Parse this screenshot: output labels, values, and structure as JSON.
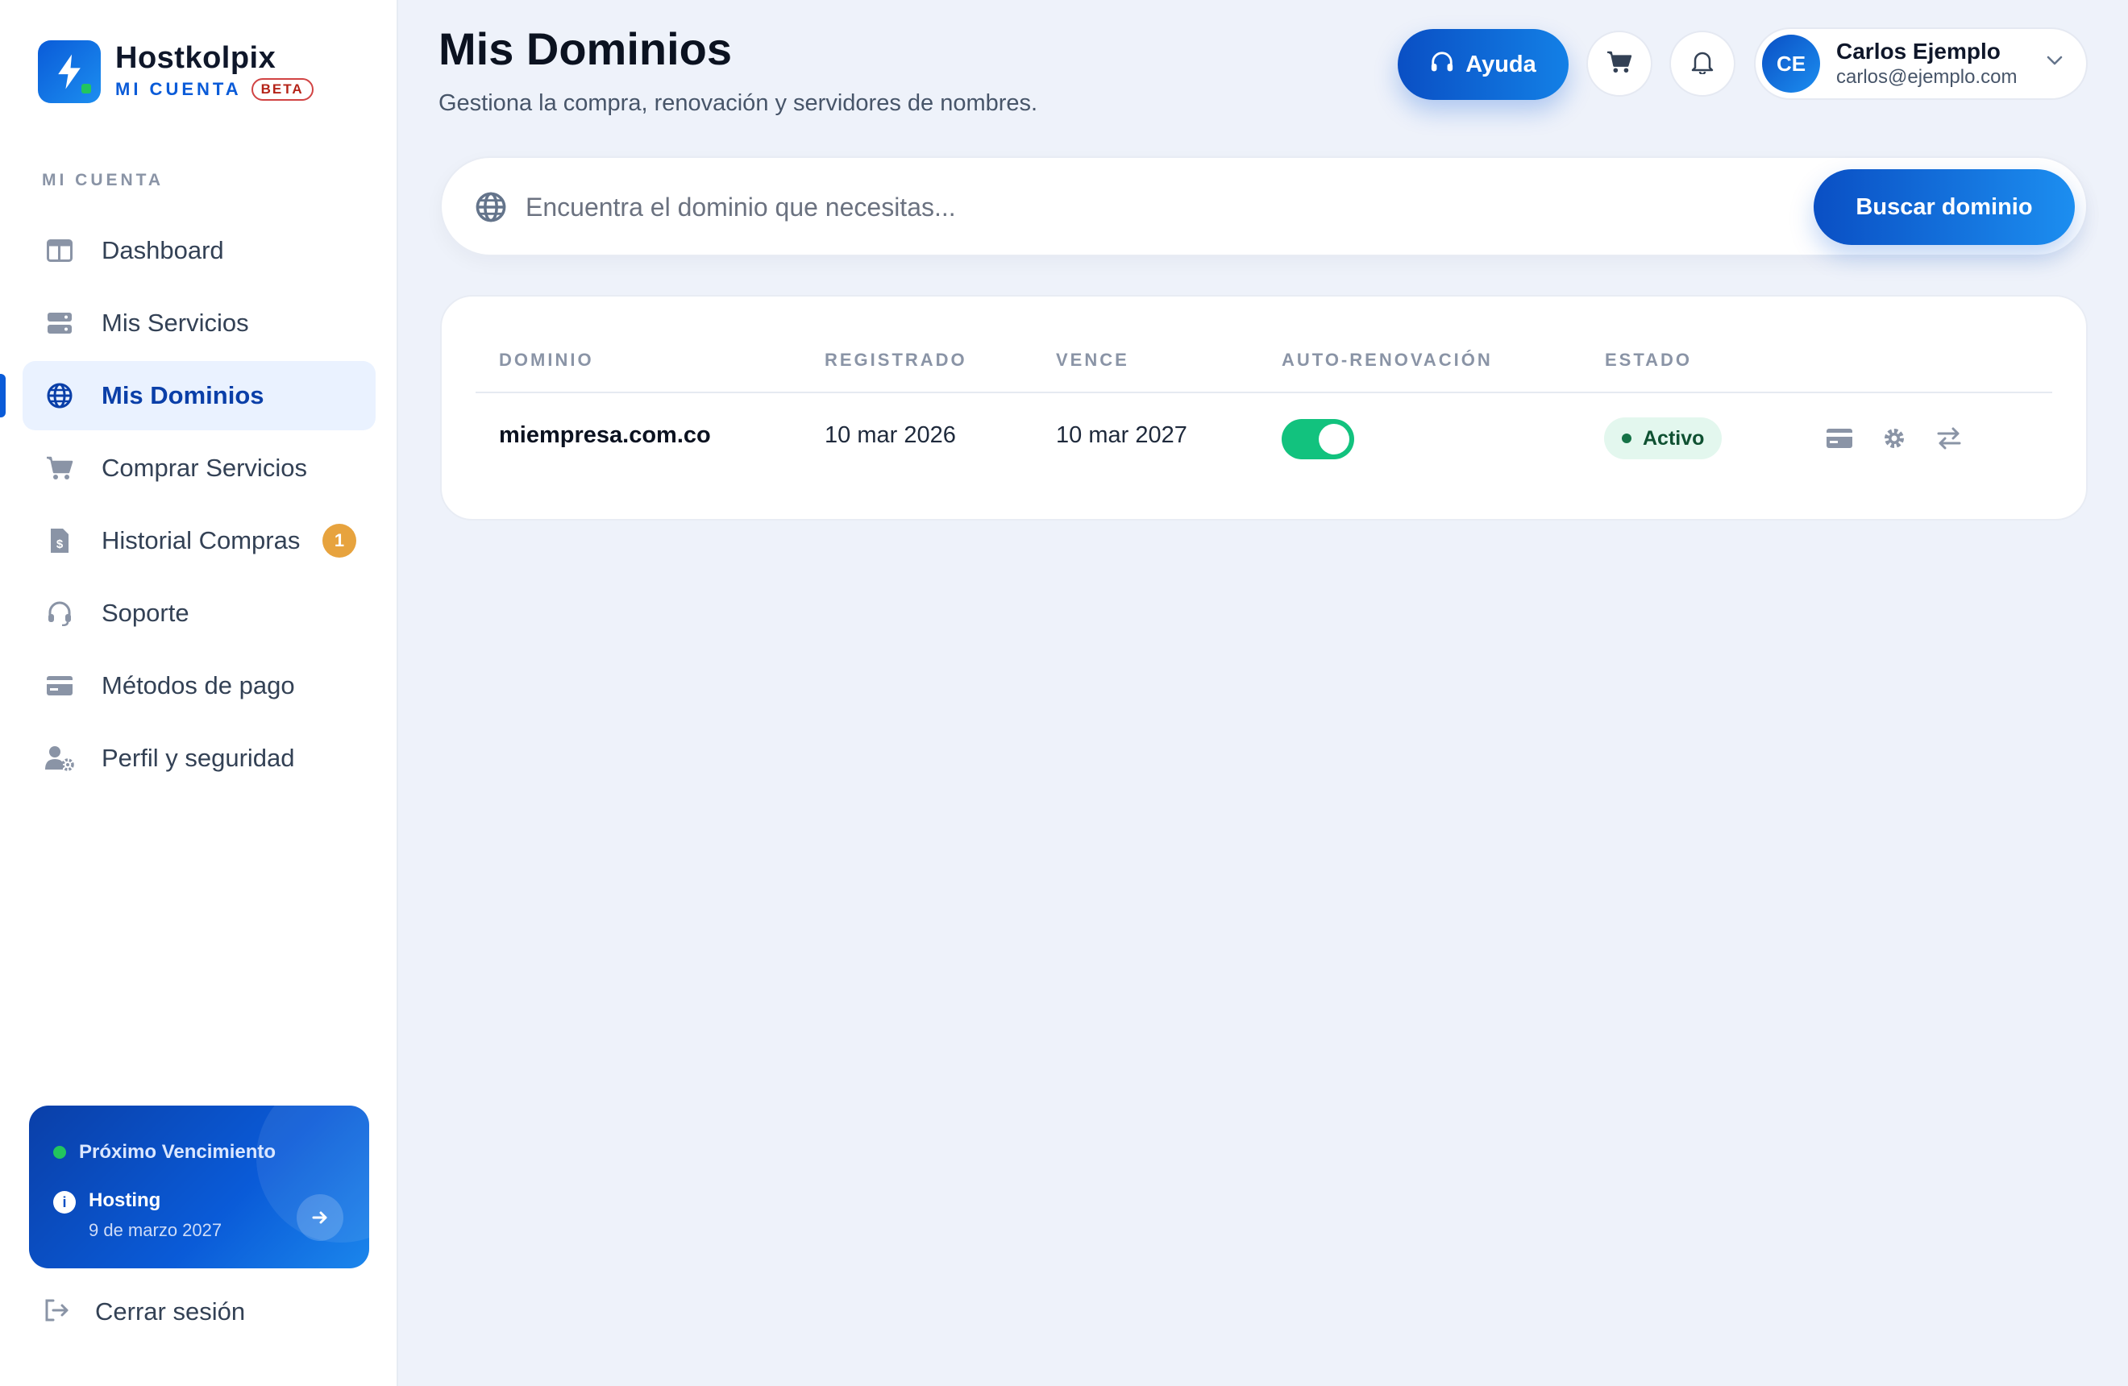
{
  "brand": {
    "name": "Hostkolpix",
    "subtitle": "MI CUENTA",
    "badge": "BETA",
    "icon": "bolt-icon"
  },
  "sidebar": {
    "section_label": "MI CUENTA",
    "items": [
      {
        "label": "Dashboard",
        "icon": "layout-icon"
      },
      {
        "label": "Mis Servicios",
        "icon": "server-icon"
      },
      {
        "label": "Mis Dominios",
        "icon": "globe-icon",
        "active": true
      },
      {
        "label": "Comprar Servicios",
        "icon": "cart-icon"
      },
      {
        "label": "Historial Compras",
        "icon": "invoice-icon",
        "badge": "1"
      },
      {
        "label": "Soporte",
        "icon": "headset-icon"
      },
      {
        "label": "Métodos de pago",
        "icon": "credit-card-icon"
      },
      {
        "label": "Perfil y seguridad",
        "icon": "user-gear-icon"
      }
    ],
    "promo": {
      "title": "Próximo Vencimiento",
      "item": "Hosting",
      "date": "9 de marzo 2027"
    },
    "logout": "Cerrar sesión"
  },
  "header": {
    "title": "Mis Dominios",
    "subtitle": "Gestiona la compra, renovación y servidores de nombres.",
    "help_label": "Ayuda",
    "user": {
      "initials": "CE",
      "name": "Carlos Ejemplo",
      "email": "carlos@ejemplo.com"
    }
  },
  "search": {
    "placeholder": "Encuentra el dominio que necesitas...",
    "value": "",
    "button": "Buscar dominio"
  },
  "table": {
    "columns": [
      "DOMINIO",
      "REGISTRADO",
      "VENCE",
      "AUTO-RENOVACIÓN",
      "ESTADO"
    ],
    "rows": [
      {
        "domain": "miempresa.com.co",
        "registered": "10 mar 2026",
        "expires": "10 mar 2027",
        "auto_renew": true,
        "status": "Activo"
      }
    ]
  },
  "colors": {
    "accent": "#0a5bd8",
    "success": "#12c27e",
    "badge": "#e7a33e",
    "background": "#eef2fa"
  }
}
